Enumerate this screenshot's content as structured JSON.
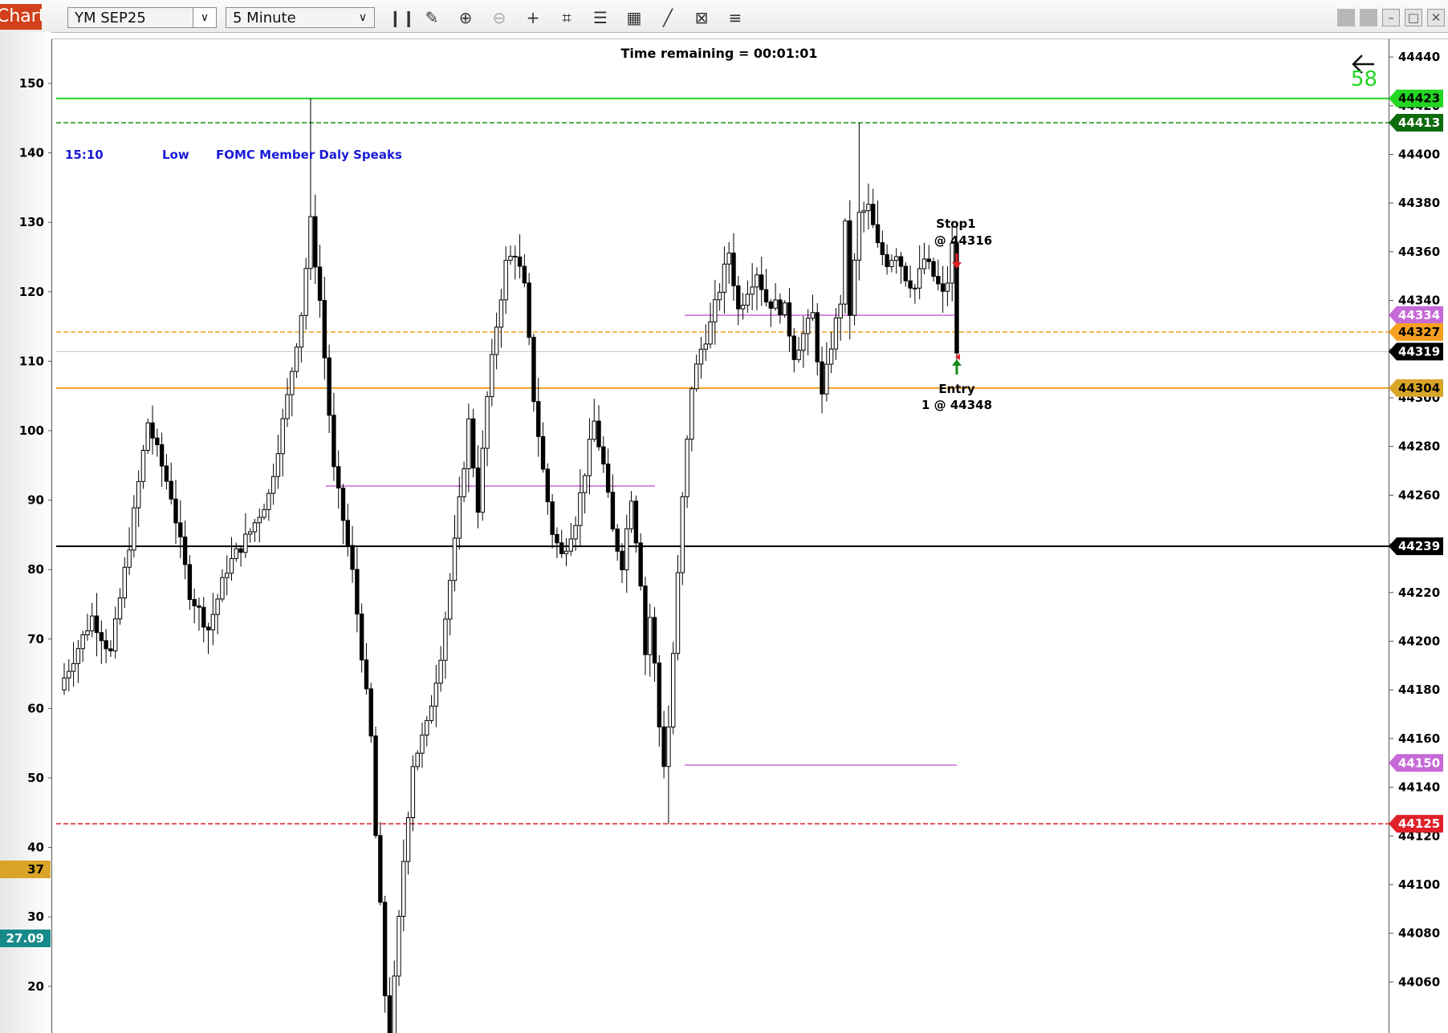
{
  "toolbar": {
    "tab_label": "Chart",
    "instrument": "YM SEP25",
    "interval": "5 Minute",
    "tools": [
      "bar-type-icon",
      "pencil-icon",
      "zoom-in-icon",
      "zoom-out-icon",
      "crosshair-icon",
      "data-box-icon",
      "templates-icon",
      "properties-icon",
      "strategies-icon",
      "indicators-icon",
      "list-icon"
    ]
  },
  "chart": {
    "timer_text": "Time remaining = 00:01:01",
    "news_event": {
      "time": "15:10",
      "impact": "Low",
      "title": "FOMC Member Daly Speaks"
    },
    "tick_counter": "58",
    "left_axis": {
      "ticks": [
        150,
        140,
        130,
        120,
        110,
        100,
        90,
        80,
        70,
        60,
        50,
        40,
        30,
        20
      ],
      "markers": [
        {
          "text": "37",
          "color": "#d9a528"
        },
        {
          "text": "27.09",
          "color": "#178a8a"
        }
      ]
    },
    "right_axis": {
      "ticks": [
        44440,
        44420,
        44400,
        44380,
        44360,
        44340,
        44320,
        44300,
        44280,
        44260,
        44240,
        44220,
        44200,
        44180,
        44160,
        44140,
        44120,
        44100,
        44080,
        44060
      ]
    },
    "price_lines": [
      {
        "price": 44423,
        "label": "44423",
        "color": "#22d622",
        "style": "solid",
        "bg": "#22d622",
        "text_color": "#000000"
      },
      {
        "price": 44413,
        "label": "44413",
        "color": "#1a8a1a",
        "style": "dashed",
        "bg": "#0e6b0e",
        "text_color": "#ffffff"
      },
      {
        "price": 44334,
        "label": "44334",
        "color": "#d58be0",
        "style": "none",
        "bg": "#c66ad6",
        "text_color": "#ffffff"
      },
      {
        "price": 44327,
        "label": "44327",
        "color": "#f0a020",
        "style": "dashed",
        "bg": "#f5a020",
        "text_color": "#000000"
      },
      {
        "price": 44319,
        "label": "44319",
        "color": "#b9c9d1",
        "style": "solid",
        "bg": "#000000",
        "text_color": "#ffffff"
      },
      {
        "price": 44304,
        "label": "44304",
        "color": "#f0a020",
        "style": "solid",
        "bg": "#d9a528",
        "text_color": "#000000"
      },
      {
        "price": 44239,
        "label": "44239",
        "color": "#000000",
        "style": "solid",
        "bg": "#000000",
        "text_color": "#ffffff"
      },
      {
        "price": 44150,
        "label": "44150",
        "color": "#d58be0",
        "style": "none",
        "bg": "#c66ad6",
        "text_color": "#ffffff"
      },
      {
        "price": 44125,
        "label": "44125",
        "color": "#e0202a",
        "style": "dashed",
        "bg": "#e0202a",
        "text_color": "#ffffff"
      }
    ],
    "orders": {
      "stop_label": "Stop1",
      "stop_price": "@ 44316",
      "entry_label": "Entry",
      "entry_price": "1 @ 44348"
    }
  }
}
